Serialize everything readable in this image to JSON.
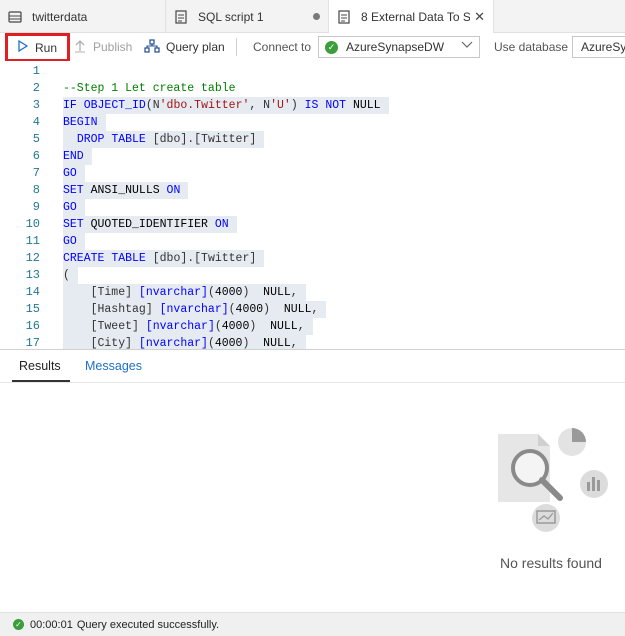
{
  "tabs": [
    {
      "label": "twitterdata",
      "icon": "database-icon"
    },
    {
      "label": "SQL script 1",
      "icon": "sql-script-icon",
      "unsaved": true
    },
    {
      "label": "8 External Data To S...",
      "icon": "sql-script-icon",
      "active": true
    }
  ],
  "toolbar": {
    "run_label": "Run",
    "publish_label": "Publish",
    "query_plan_label": "Query plan",
    "connect_to_label": "Connect to",
    "connection_value": "AzureSynapseDW",
    "use_database_label": "Use database",
    "database_value": "AzureSynapseDW"
  },
  "editor": {
    "lines": [
      {
        "n": "1",
        "text": ""
      },
      {
        "n": "2",
        "text": "--Step 1 Let create table"
      },
      {
        "n": "3",
        "text": "IF OBJECT_ID(N'dbo.Twitter', N'U') IS NOT NULL"
      },
      {
        "n": "4",
        "text": "BEGIN"
      },
      {
        "n": "5",
        "text": "  DROP TABLE [dbo].[Twitter]"
      },
      {
        "n": "6",
        "text": "END"
      },
      {
        "n": "7",
        "text": "GO"
      },
      {
        "n": "8",
        "text": "SET ANSI_NULLS ON"
      },
      {
        "n": "9",
        "text": "GO"
      },
      {
        "n": "10",
        "text": "SET QUOTED_IDENTIFIER ON"
      },
      {
        "n": "11",
        "text": "GO"
      },
      {
        "n": "12",
        "text": "CREATE TABLE [dbo].[Twitter]"
      },
      {
        "n": "13",
        "text": "("
      },
      {
        "n": "14",
        "text": "    [Time] [nvarchar](4000)  NULL,"
      },
      {
        "n": "15",
        "text": "    [Hashtag] [nvarchar](4000)  NULL,"
      },
      {
        "n": "16",
        "text": "    [Tweet] [nvarchar](4000)  NULL,"
      },
      {
        "n": "17",
        "text": "    [City] [nvarchar](4000)  NULL,"
      }
    ]
  },
  "results": {
    "tabs": [
      "Results",
      "Messages"
    ],
    "active_tab": "Results",
    "empty_message": "No results found"
  },
  "status": {
    "elapsed": "00:00:01",
    "message": "Query executed successfully."
  },
  "colors": {
    "run_highlight": "#e02020",
    "success": "#3b9d3b",
    "keyword": "#0000ff",
    "string": "#a31515",
    "comment": "#008000",
    "line_number": "#237893",
    "selection": "#e5ebf1"
  }
}
